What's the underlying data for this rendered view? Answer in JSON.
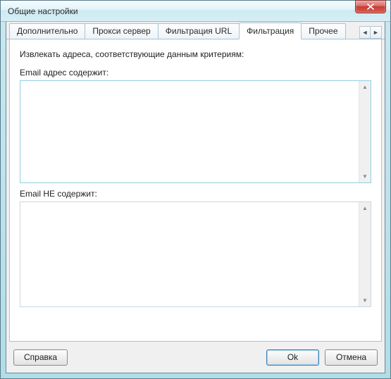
{
  "window": {
    "title": "Общие настройки"
  },
  "tabs": {
    "items": [
      {
        "label": "Дополнительно",
        "active": false
      },
      {
        "label": "Прокси сервер",
        "active": false
      },
      {
        "label": "Фильтрация URL",
        "active": false
      },
      {
        "label": "Фильтрация",
        "active": true
      },
      {
        "label": "Прочее",
        "active": false
      }
    ]
  },
  "panel": {
    "instruction": "Извлекать адреса, соответствующие данным критериям:",
    "contains_label": "Email адрес содержит:",
    "contains_value": "",
    "not_contains_label": "Email НЕ содержит:",
    "not_contains_value": ""
  },
  "buttons": {
    "help": "Справка",
    "ok": "Ok",
    "cancel": "Отмена"
  }
}
